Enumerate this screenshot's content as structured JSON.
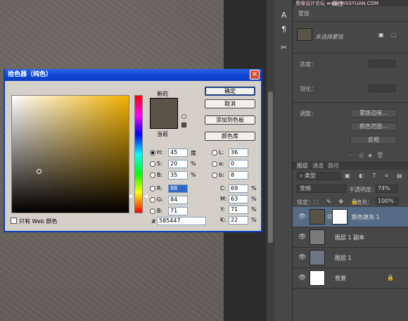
{
  "watermark": {
    "text": "思缘设计论坛 www.MISSYUAN.COM"
  },
  "panel": {
    "properties_tab": "属性",
    "mask_label": "蒙版",
    "mask_selected": "未选择蒙版",
    "density_label": "浓度：",
    "feather_label": "羽化：",
    "refine_label": "调整：",
    "mask_edge_btn": "蒙版边缘...",
    "color_range_btn": "颜色范围...",
    "invert_btn": "反相",
    "layers_tab": "图层",
    "channels_tab": "通道",
    "paths_tab": "路径",
    "kind_filter": "类型",
    "blend_mode": "变暗",
    "opacity_label": "不透明度：",
    "opacity_value": "74%",
    "lock_label": "锁定：",
    "fill_label": "填充：",
    "fill_value": "100%",
    "layers": [
      {
        "name": "颜色填充 1",
        "selected": true,
        "thumb_color": "#585447",
        "has_mask": true
      },
      {
        "name": "图层 1 副本",
        "selected": false,
        "thumb_color": "#7a7a7a",
        "has_mask": false
      },
      {
        "name": "图层 1",
        "selected": false,
        "thumb_color": "#6d7482",
        "has_mask": false
      },
      {
        "name": "背景",
        "selected": false,
        "thumb_color": "#ffffff",
        "has_mask": false,
        "locked": true
      }
    ]
  },
  "dialog": {
    "title": "拾色器（纯色）",
    "close": "×",
    "new_label": "新的",
    "current_label": "当前",
    "new_color": "#585447",
    "current_color": "#585447",
    "ok_button": "确定",
    "cancel_button": "取消",
    "add_swatch_button": "添加到色板",
    "color_library_button": "颜色库",
    "web_only_label": "只有 Web 颜色",
    "hsb": [
      {
        "label": "H:",
        "value": "45",
        "unit": "度",
        "selected": true
      },
      {
        "label": "S:",
        "value": "20",
        "unit": "%",
        "selected": false
      },
      {
        "label": "B:",
        "value": "35",
        "unit": "%",
        "selected": false
      }
    ],
    "rgb": [
      {
        "label": "R:",
        "value": "88"
      },
      {
        "label": "G:",
        "value": "84"
      },
      {
        "label": "B:",
        "value": "71"
      }
    ],
    "lab": [
      {
        "label": "L:",
        "value": "36"
      },
      {
        "label": "a:",
        "value": "0"
      },
      {
        "label": "b:",
        "value": "8"
      }
    ],
    "cmyk": [
      {
        "label": "C:",
        "value": "69",
        "unit": "%"
      },
      {
        "label": "M:",
        "value": "63",
        "unit": "%"
      },
      {
        "label": "Y:",
        "value": "71",
        "unit": "%"
      },
      {
        "label": "K:",
        "value": "22",
        "unit": "%"
      }
    ],
    "hex_label": "#",
    "hex_value": "585447"
  },
  "icons": {
    "tool1": "A",
    "tool2": "¶",
    "tool3": "✂",
    "eye": "👁",
    "lock": "🔒"
  }
}
